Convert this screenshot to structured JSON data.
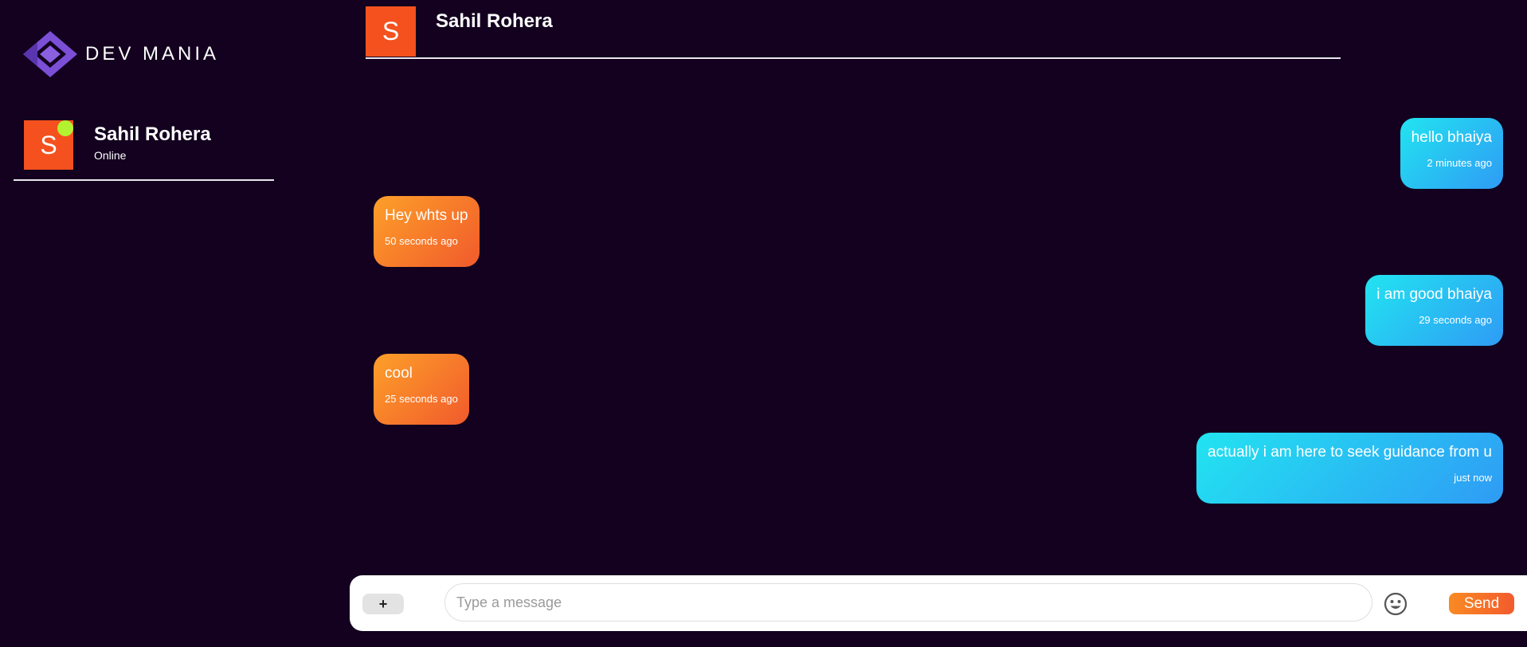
{
  "brand": {
    "name": "DEV MANIA",
    "logo_icon": "diamond-logo-icon",
    "logo_color": "#7b4fd6"
  },
  "sidebar": {
    "contacts": [
      {
        "initial": "S",
        "name": "Sahil Rohera",
        "status": "Online",
        "avatar_color": "#f4511e",
        "online_color": "#b2f230"
      }
    ]
  },
  "chat": {
    "header": {
      "initial": "S",
      "name": "Sahil Rohera"
    },
    "messages": [
      {
        "direction": "out",
        "text": "hello bhaiya",
        "time": "2 minutes ago"
      },
      {
        "direction": "in",
        "text": "Hey whts up",
        "time": "50 seconds ago"
      },
      {
        "direction": "out",
        "text": "i am good bhaiya",
        "time": "29 seconds ago"
      },
      {
        "direction": "in",
        "text": "cool",
        "time": "25 seconds ago"
      },
      {
        "direction": "out",
        "text": "actually i am here to seek guidance from u",
        "time": "just now"
      }
    ]
  },
  "composer": {
    "attach_label": "+",
    "placeholder": "Type a message",
    "value": "",
    "emoji_icon": "smiley-icon",
    "send_label": "Send"
  },
  "colors": {
    "background": "#13011f",
    "outgoing_gradient": [
      "#22e4f0",
      "#2f9bf5"
    ],
    "incoming_gradient": [
      "#fda029",
      "#f15a2c"
    ]
  }
}
